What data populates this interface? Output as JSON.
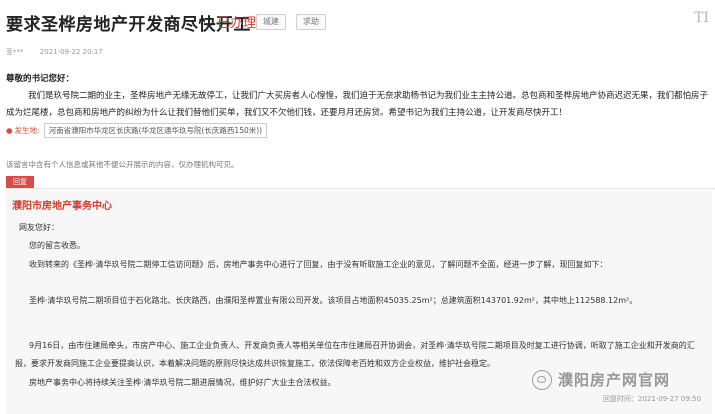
{
  "header": {
    "title": "要求圣桦房地产开发商尽快开工",
    "status": "已办理",
    "tags": [
      "城建",
      "求助"
    ],
    "logo_mark": "TI"
  },
  "meta": {
    "author": "圣***",
    "time": "2021-09-22 20:17"
  },
  "message": {
    "greeting": "尊敬的书记您好：",
    "body": "我们是玖号院二期的业主，圣桦房地产无缘无故停工，让我们广大买房者人心惶惶，我们迫于无奈求助杨书记为我们业主主持公道。总包商和圣桦房地产协商迟迟无果，我们都怕房子成为烂尾楼，总包商和房地产的纠纷为什么让我们替他们买单，我们又不欠他们钱，还要月月还房贷。希望书记为我们主持公道，让开发商尽快开工！",
    "location_key": "发生地:",
    "location_value": "河南省濮阳市华龙区长庆路(华龙区通华玖号院(长庆路西150米))"
  },
  "notice": "该留言中含有个人信息或其他不便公开展示的内容，仅办理机构可见。",
  "reply": {
    "tab_label": "回复",
    "department": "濮阳市房地产事务中心",
    "greeting": "网友您好：",
    "p1": "您的留言收悉。",
    "p2": "收到转来的《圣桦·清华玖号院二期停工信访问题》后，房地产事务中心进行了回复，由于没有听取施工企业的意见，了解问题不全面，经进一步了解，现回复如下：",
    "p3": "圣桦·清华玖号院二期项目位于石化路北、长庆路西，由濮阳圣桦置业有限公司开发。该项目占地面积45035.25m²；总建筑面积143701.92m²，其中地上112588.12m²。",
    "p4": "9月16日，由市住建局牵头，市房产中心、施工企业负责人、开发商负责人等相关单位在市住建局召开协调会，对圣桦·清华玖号院二期项目及时复工进行协调，听取了施工企业和开发商的汇报，要求开发商同施工企业要提高认识，本着解决问题的原则尽快达成共识恢复施工，依法保障老百姓和双方企业权益，维护社会稳定。",
    "p5": "房地产事务中心将持续关注圣桦·清华玖号院二期进展情况，维护好广大业主合法权益。",
    "time": "回复时间：2021-09-27 09:50"
  },
  "watermark": "濮阳房产网官网"
}
